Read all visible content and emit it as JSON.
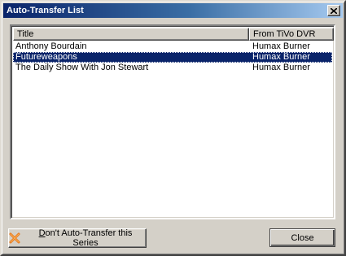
{
  "window": {
    "title": "Auto-Transfer List"
  },
  "list": {
    "columns": [
      {
        "label": "Title"
      },
      {
        "label": "From TiVo DVR"
      }
    ],
    "rows": [
      {
        "title": "Anthony Bourdain",
        "source": "Humax Burner",
        "selected": false
      },
      {
        "title": "Futureweapons",
        "source": "Humax Burner",
        "selected": true
      },
      {
        "title": "The Daily Show With Jon Stewart",
        "source": "Humax Burner",
        "selected": false
      }
    ]
  },
  "buttons": {
    "dont_transfer": {
      "mnemonic": "D",
      "label_rest": "on't Auto-Transfer this Series",
      "icon": "x-icon",
      "icon_color": "#e8761a"
    },
    "close": {
      "label": "Close"
    }
  },
  "colors": {
    "selection": "#0a246a",
    "titlebar_start": "#0a246a",
    "titlebar_end": "#a6caf0",
    "face": "#d4d0c8"
  }
}
